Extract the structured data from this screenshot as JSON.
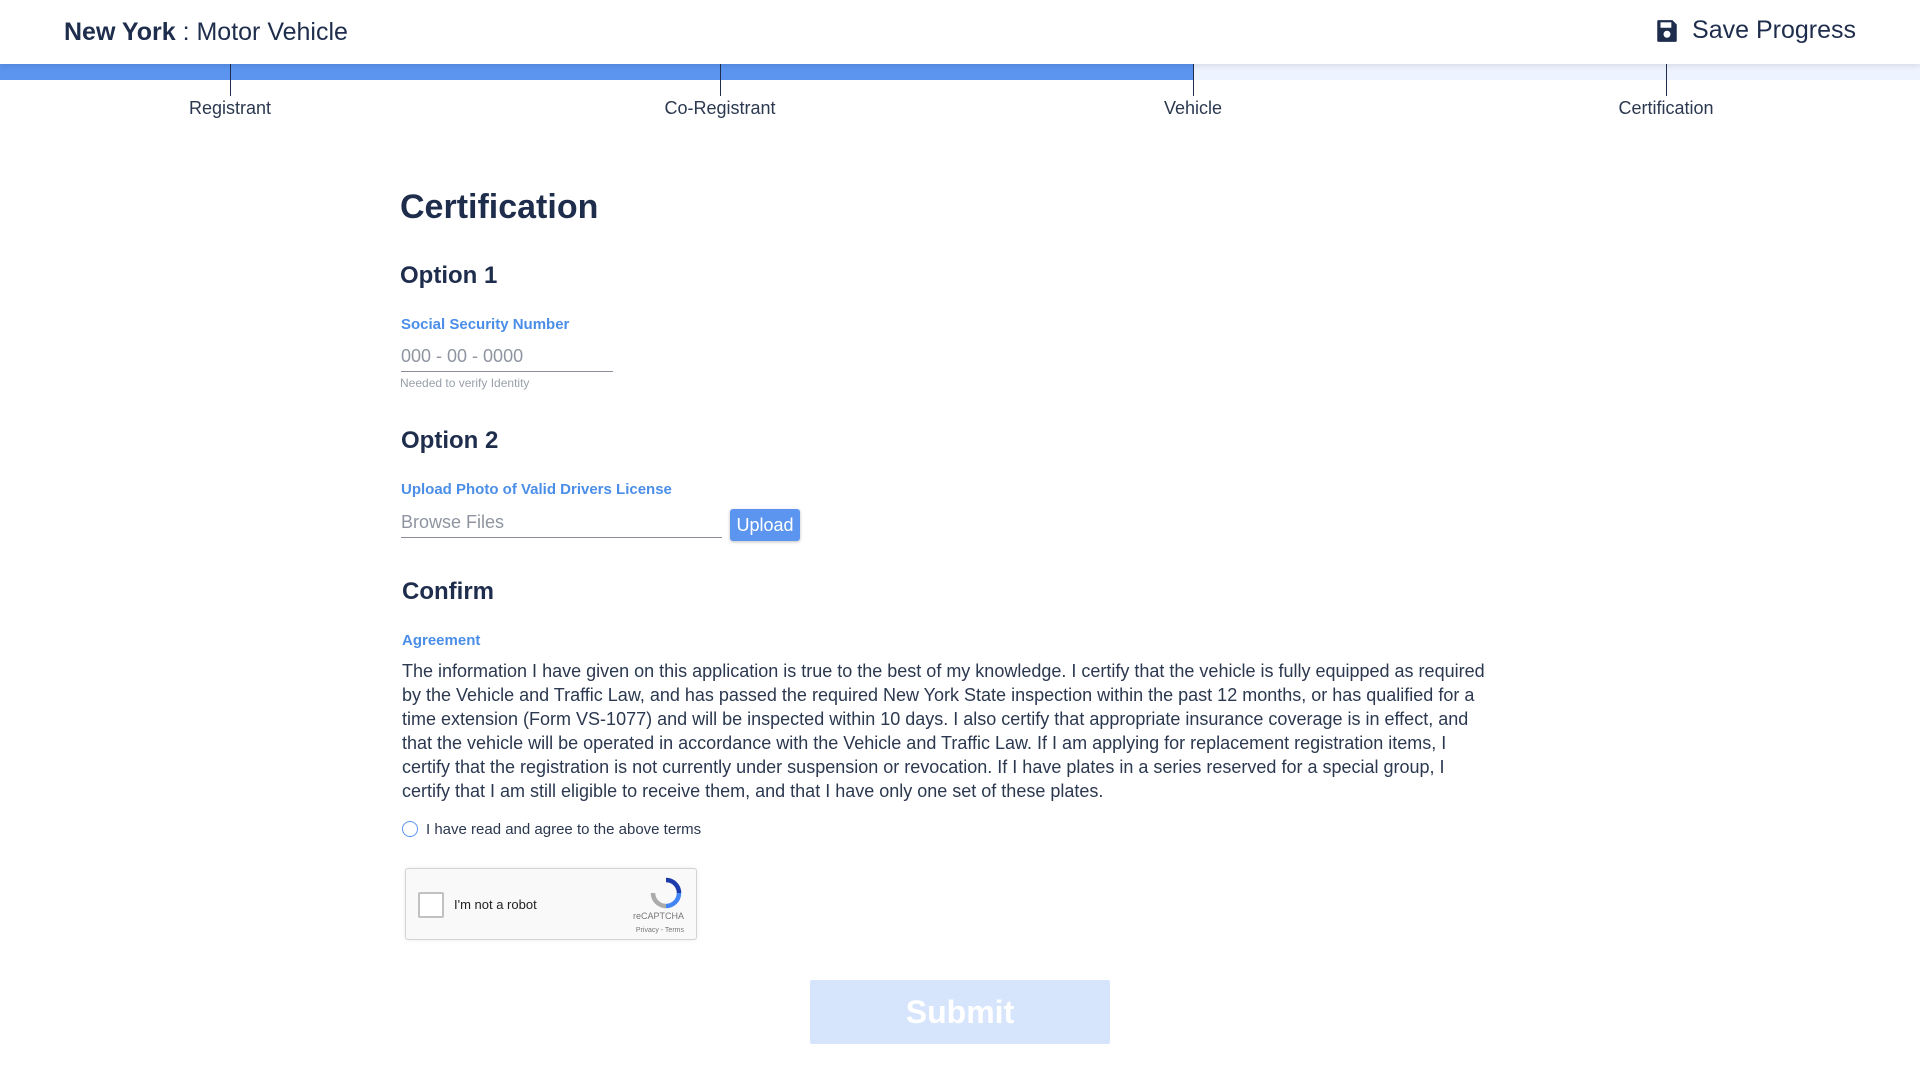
{
  "header": {
    "state": "New York",
    "separator": " : ",
    "agency": "Motor Vehicle",
    "save_label": "Save Progress"
  },
  "progress": {
    "completed_fraction": 0.62,
    "steps": [
      {
        "label": "Registrant"
      },
      {
        "label": "Co-Registrant"
      },
      {
        "label": "Vehicle"
      },
      {
        "label": "Certification"
      }
    ]
  },
  "page": {
    "title": "Certification"
  },
  "option1": {
    "heading": "Option 1",
    "ssn_label": "Social Security Number",
    "ssn_placeholder": "000 - 00 - 0000",
    "ssn_hint": "Needed to verify Identity"
  },
  "option2": {
    "heading": "Option 2",
    "upload_label": "Upload Photo of Valid Drivers License",
    "browse_placeholder": "Browse Files",
    "upload_button": "Upload"
  },
  "confirm": {
    "heading": "Confirm",
    "agreement_label": "Agreement",
    "agreement_text": "The information I have given on this application is true to the best of my knowledge. I certify that the vehicle is fully equipped as required by the Vehicle and Traffic Law, and has passed the required New York State inspection within the past 12 months, or has qualified for a time extension (Form VS-1077) and will be inspected within 10 days. I also certify that appropriate insurance coverage is in effect, and that the vehicle will be operated in accordance with the Vehicle and Traffic Law. If I am applying for replacement registration items, I certify that the registration is not currently under suspension or revocation. If I have plates in a series reserved for a special group, I certify that I am still eligible to receive them, and that I have only one set of these plates.",
    "agree_label": "I have read and agree to the above terms"
  },
  "recaptcha": {
    "label": "I'm not a robot",
    "brand": "reCAPTCHA",
    "links": "Privacy - Terms"
  },
  "submit_label": "Submit",
  "colors": {
    "accent": "#5b95ef",
    "label_blue": "#4a8ee8",
    "heading": "#1f2d4d",
    "submit_disabled": "#d6e5fc"
  }
}
